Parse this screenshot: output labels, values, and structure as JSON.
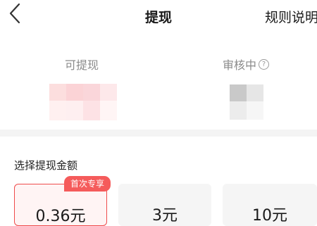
{
  "nav": {
    "back_icon": "chevron-left-icon",
    "title": "提现",
    "rules_link": "规则说明"
  },
  "balance": {
    "available_label": "可提现",
    "review_label": "审核中",
    "help_icon": "question-circle-icon",
    "help_glyph": "?"
  },
  "section": {
    "select_amount_label": "选择提现金额"
  },
  "options": [
    {
      "value": "0.36元",
      "badge": "首次专享",
      "selected": true
    },
    {
      "value": "3元",
      "selected": false
    },
    {
      "value": "10元",
      "selected": false
    }
  ],
  "colors": {
    "accent": "#f55b5b",
    "selected_border": "#ef4b4b",
    "selected_bg": "#fff4f4",
    "card_bg": "#f5f5f5",
    "divider": "#f4f4f4"
  }
}
